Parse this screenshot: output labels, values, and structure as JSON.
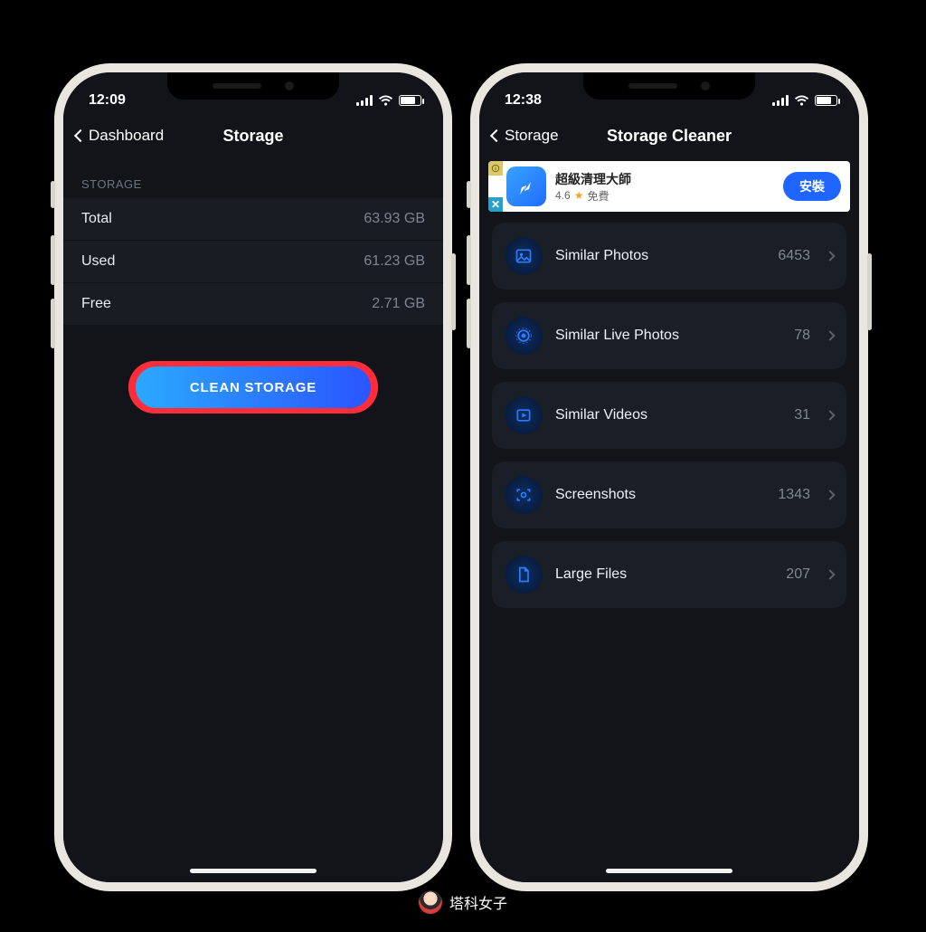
{
  "left": {
    "status": {
      "time": "12:09"
    },
    "nav": {
      "back": "Dashboard",
      "title": "Storage"
    },
    "section_header": "STORAGE",
    "rows": [
      {
        "k": "Total",
        "v": "63.93 GB"
      },
      {
        "k": "Used",
        "v": "61.23 GB"
      },
      {
        "k": "Free",
        "v": "2.71 GB"
      }
    ],
    "clean_label": "CLEAN STORAGE"
  },
  "right": {
    "status": {
      "time": "12:38"
    },
    "nav": {
      "back": "Storage",
      "title": "Storage Cleaner"
    },
    "ad": {
      "title": "超級清理大師",
      "rating": "4.6",
      "price": "免費",
      "cta": "安裝",
      "close_glyph": "✕"
    },
    "items": [
      {
        "icon": "image-icon",
        "label": "Similar Photos",
        "count": "6453"
      },
      {
        "icon": "live-photo-icon",
        "label": "Similar Live Photos",
        "count": "78"
      },
      {
        "icon": "video-icon",
        "label": "Similar Videos",
        "count": "31"
      },
      {
        "icon": "screenshot-icon",
        "label": "Screenshots",
        "count": "1343"
      },
      {
        "icon": "file-icon",
        "label": "Large Files",
        "count": "207"
      }
    ]
  },
  "watermark": "塔科女子"
}
